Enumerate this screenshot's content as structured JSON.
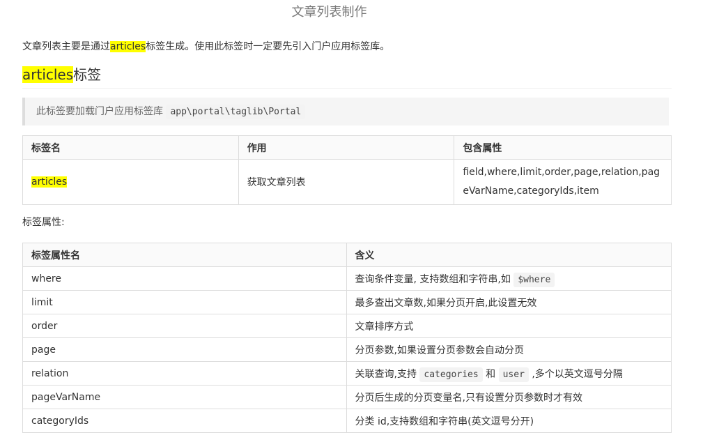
{
  "page_title": "文章列表制作",
  "intro": {
    "before": "文章列表主要是通过",
    "highlight": "articles",
    "after": "标签生成。使用此标签时一定要先引入门户应用标签库。"
  },
  "section": {
    "highlight": "articles",
    "rest": "标签"
  },
  "note": {
    "text": "此标签要加载门户应用标签库",
    "code": "app\\portal\\taglib\\Portal"
  },
  "tags_table": {
    "headers": [
      "标签名",
      "作用",
      "包含属性"
    ],
    "row": {
      "name": "articles",
      "purpose": "获取文章列表",
      "attributes": "field,where,limit,order,page,relation,pageVarName,categoryIds,item"
    }
  },
  "attr_caption": "标签属性:",
  "attr_table": {
    "headers": [
      "标签属性名",
      "含义"
    ],
    "rows": [
      {
        "name": "where",
        "meaning_before": "查询条件变量, 支持数组和字符串,如 ",
        "code1": "$where"
      },
      {
        "name": "limit",
        "meaning_before": "最多查出文章数,如果分页开启,此设置无效"
      },
      {
        "name": "order",
        "meaning_before": "文章排序方式"
      },
      {
        "name": "page",
        "meaning_before": "分页参数,如果设置分页参数会自动分页"
      },
      {
        "name": "relation",
        "meaning_before": "关联查询,支持 ",
        "code1": "categories",
        "mid": " 和 ",
        "code2": "user",
        "meaning_after": " ,多个以英文逗号分隔"
      },
      {
        "name": "pageVarName",
        "meaning_before": "分页后生成的分页变量名,只有设置分页参数时才有效"
      },
      {
        "name": "categoryIds",
        "meaning_before": "分类 id,支持数组和字符串(英文逗号分开)"
      }
    ]
  }
}
